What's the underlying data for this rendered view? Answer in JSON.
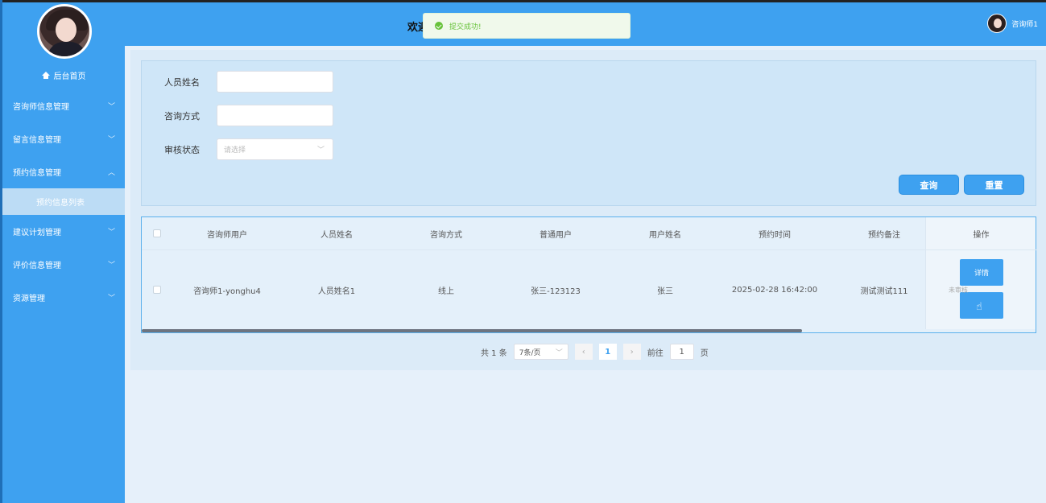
{
  "header": {
    "welcome": "欢迎",
    "username": "咨询师1"
  },
  "toast": {
    "message": "提交成功!"
  },
  "sidebar": {
    "home": "后台首页",
    "items": [
      {
        "label": "咨询师信息管理",
        "chevron": "﹀"
      },
      {
        "label": "留言信息管理",
        "chevron": "﹀"
      },
      {
        "label": "预约信息管理",
        "chevron": "︿"
      },
      {
        "label": "建议计划管理",
        "chevron": "﹀"
      },
      {
        "label": "评价信息管理",
        "chevron": "﹀"
      },
      {
        "label": "资源管理",
        "chevron": "﹀"
      }
    ],
    "active_sub": "预约信息列表"
  },
  "search": {
    "name_label": "人员姓名",
    "name_value": "",
    "method_label": "咨询方式",
    "method_value": "",
    "status_label": "审核状态",
    "status_placeholder": "请选择",
    "query_btn": "查询",
    "reset_btn": "重置"
  },
  "table": {
    "headers": [
      "咨询师用户",
      "人员姓名",
      "咨询方式",
      "普通用户",
      "用户姓名",
      "预约时间",
      "预约备注"
    ],
    "op_header": "操作",
    "rows": [
      {
        "cells": [
          "咨询师1-yonghu4",
          "人员姓名1",
          "线上",
          "张三-123123",
          "张三",
          "2025-02-28 16:42:00",
          "测试测试111"
        ],
        "audit_status": "未审核",
        "detail_btn": "详情"
      }
    ]
  },
  "pager": {
    "total": "共 1 条",
    "page_size": "7条/页",
    "current_page": "1",
    "jump_prefix": "前往",
    "jump_value": "1",
    "jump_suffix": "页"
  },
  "colors": {
    "primary": "#3ea1f0",
    "success": "#67c23a",
    "toast_bg": "#f0f9eb"
  }
}
